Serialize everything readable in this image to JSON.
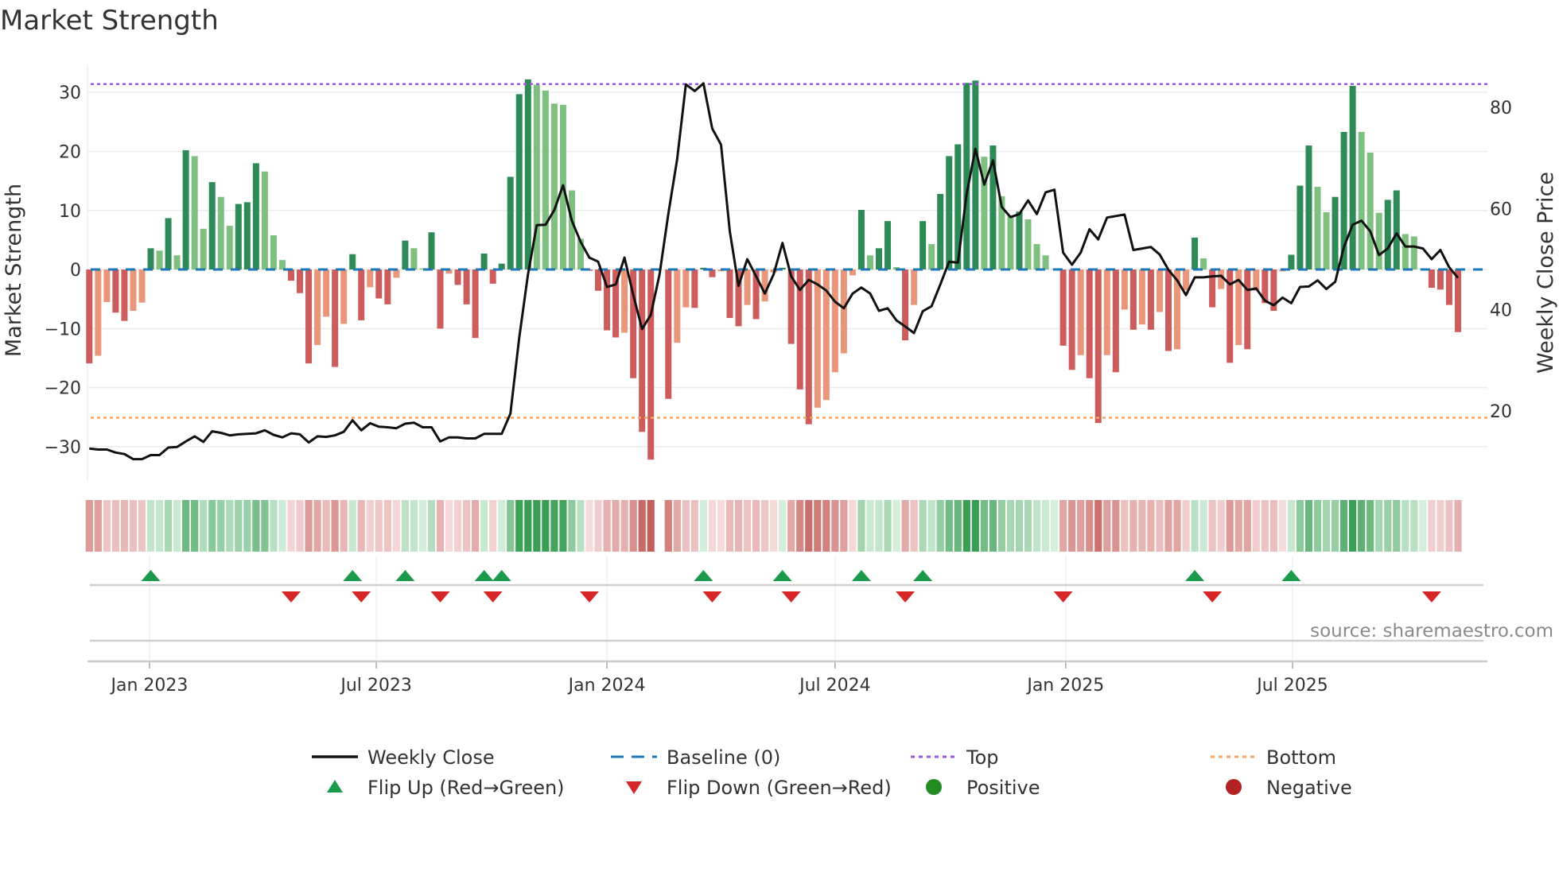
{
  "title": "Market Strength",
  "source": "source: sharemaestro.com",
  "chart_data": {
    "type": "bar",
    "title": "Market Strength",
    "frequency": "weekly",
    "first_week": "2022-11-14",
    "ylabel": "Market Strength",
    "y2label": "Weekly Close Price",
    "ylim": [
      -35.8,
      34.6
    ],
    "y2lim": [
      6.2,
      88.3
    ],
    "yticks": [
      -30,
      -20,
      -10,
      0,
      10,
      20,
      30
    ],
    "ytick_labels": [
      "−30",
      "−20",
      "−10",
      "0",
      "10",
      "20",
      "30"
    ],
    "y2ticks": [
      20,
      40,
      60,
      80
    ],
    "y2tick_labels": [
      "20",
      "40",
      "60",
      "80"
    ],
    "xticks": [
      "2023-01-01",
      "2023-07-01",
      "2024-01-01",
      "2024-07-01",
      "2025-01-01",
      "2025-07-01"
    ],
    "xtick_labels": [
      "Jan 2023",
      "Jul 2023",
      "Jan 2024",
      "Jul 2024",
      "Jan 2025",
      "Jul 2025"
    ],
    "top_level": 31.4,
    "bottom_level": -25.1,
    "baseline": 0,
    "strength": [
      -15.9,
      -14.6,
      -5.5,
      -7.3,
      -8.7,
      -7.0,
      -5.6,
      3.6,
      3.2,
      8.7,
      2.4,
      20.2,
      19.2,
      6.9,
      14.8,
      12.3,
      7.4,
      11.1,
      11.4,
      18.0,
      16.6,
      5.8,
      1.6,
      -1.9,
      -4.0,
      -15.9,
      -12.8,
      -8.0,
      -16.5,
      -9.2,
      2.6,
      -8.6,
      -3.0,
      -4.9,
      -5.9,
      -1.4,
      4.9,
      3.6,
      0.2,
      6.3,
      -10.0,
      -0.7,
      -2.6,
      -5.9,
      -11.6,
      2.7,
      -2.4,
      1.0,
      15.7,
      29.7,
      32.2,
      31.3,
      30.3,
      28.1,
      27.9,
      13.4,
      5.2,
      -0.2,
      -3.6,
      -10.3,
      -11.5,
      -10.7,
      -18.4,
      -27.5,
      -32.2,
      null,
      -21.9,
      -12.4,
      -6.4,
      -6.5,
      0.3,
      -1.3,
      -0.3,
      -8.2,
      -9.6,
      -6.0,
      -8.4,
      -5.4,
      -0.5,
      0.3,
      -12.6,
      -20.3,
      -26.2,
      -23.4,
      -22.1,
      -17.4,
      -14.2,
      -1.0,
      10.1,
      2.4,
      3.6,
      8.2,
      0.4,
      -12.0,
      -6.0,
      8.2,
      4.3,
      12.8,
      19.2,
      21.2,
      31.6,
      32.0,
      19.1,
      21.0,
      12.4,
      9.0,
      9.8,
      8.5,
      4.3,
      2.4,
      0.1,
      -12.9,
      -17.0,
      -14.5,
      -18.4,
      -26.0,
      -14.5,
      -17.4,
      -6.8,
      -10.2,
      -9.3,
      -10.2,
      -7.2,
      -13.8,
      -13.5,
      -3.5,
      5.4,
      1.9,
      -6.4,
      -3.3,
      -15.8,
      -12.8,
      -13.5,
      -3.6,
      -5.7,
      -7.0,
      -0.3,
      2.5,
      14.2,
      21.0,
      14.0,
      9.7,
      12.3,
      23.3,
      31.1,
      23.3,
      19.8,
      9.6,
      11.8,
      13.4,
      6.0,
      5.6,
      0.2,
      -3.1,
      -3.4,
      -6.0,
      -10.6
    ],
    "weekly_close": [
      12.6,
      12.4,
      12.4,
      11.8,
      11.5,
      10.5,
      10.5,
      11.3,
      11.3,
      12.8,
      12.9,
      14.0,
      15.0,
      13.9,
      16.0,
      15.7,
      15.2,
      15.4,
      15.5,
      15.6,
      16.2,
      15.3,
      14.8,
      15.6,
      15.4,
      13.8,
      15.0,
      14.9,
      15.2,
      15.9,
      18.2,
      16.2,
      17.6,
      16.9,
      16.8,
      16.6,
      17.5,
      17.7,
      16.8,
      16.8,
      14.0,
      14.8,
      14.8,
      14.6,
      14.6,
      15.5,
      15.5,
      15.5,
      19.5,
      34.5,
      47,
      56.7,
      56.8,
      59.7,
      64.6,
      57.6,
      53.4,
      50.3,
      49.5,
      44.5,
      45,
      50.3,
      42.9,
      36.2,
      39,
      47,
      59,
      69.7,
      84.5,
      83.2,
      84.7,
      75.8,
      72.6,
      55.5,
      44.7,
      50,
      46.6,
      43.2,
      47,
      53.2,
      46.6,
      43.9,
      45.9,
      45,
      43.8,
      41.6,
      40.3,
      43.2,
      44.4,
      43.2,
      39.8,
      40.3,
      37.9,
      36.7,
      35.4,
      39.7,
      40.7,
      45,
      49.5,
      49.3,
      62.9,
      71.8,
      64.7,
      69.5,
      60.3,
      58.3,
      58.9,
      61.6,
      58.9,
      63.2,
      63.7,
      51.3,
      48.9,
      51.3,
      55.9,
      53.9,
      58.2,
      58.5,
      58.8,
      51.8,
      52.1,
      52.4,
      50.9,
      47.9,
      45.8,
      42.9,
      46.4,
      46.4,
      46.6,
      46.7,
      45,
      45.9,
      43.9,
      44.2,
      41.8,
      40.9,
      42.4,
      41.3,
      44.5,
      44.6,
      45.8,
      44.1,
      45.5,
      52.4,
      56.8,
      57.6,
      55.5,
      50.8,
      52.1,
      55.1,
      52.5,
      52.5,
      52.1,
      50,
      51.8,
      48.4,
      46.3
    ],
    "flip_up_weeks": [
      7,
      30,
      36,
      45,
      47,
      70,
      79,
      88,
      95,
      126,
      137
    ],
    "flip_down_weeks": [
      23,
      31,
      40,
      46,
      57,
      71,
      80,
      93,
      111,
      128,
      153
    ],
    "colors": {
      "pos_strong": "#2e8b57",
      "pos_weak": "#7fbf7f",
      "neg_strong": "#cd5c5c",
      "neg_weak": "#e9967a",
      "close": "#111111",
      "baseline": "#1f77b4",
      "top": "#9b59d6",
      "bottom": "#f4a460",
      "flip_up": "#1a9a4a",
      "flip_down": "#d62728",
      "positive": "#228b22",
      "negative": "#b22222"
    },
    "legend_position": "bottom",
    "legend": [
      {
        "label": "Weekly Close",
        "kind": "line"
      },
      {
        "label": "Baseline (0)",
        "kind": "dash"
      },
      {
        "label": "Top",
        "kind": "dot-top"
      },
      {
        "label": "Bottom",
        "kind": "dot-bottom"
      },
      {
        "label": "Flip Up (Red→Green)",
        "kind": "tri-up"
      },
      {
        "label": "Flip Down (Green→Red)",
        "kind": "tri-down"
      },
      {
        "label": "Positive",
        "kind": "dot-pos"
      },
      {
        "label": "Negative",
        "kind": "dot-neg"
      }
    ]
  }
}
